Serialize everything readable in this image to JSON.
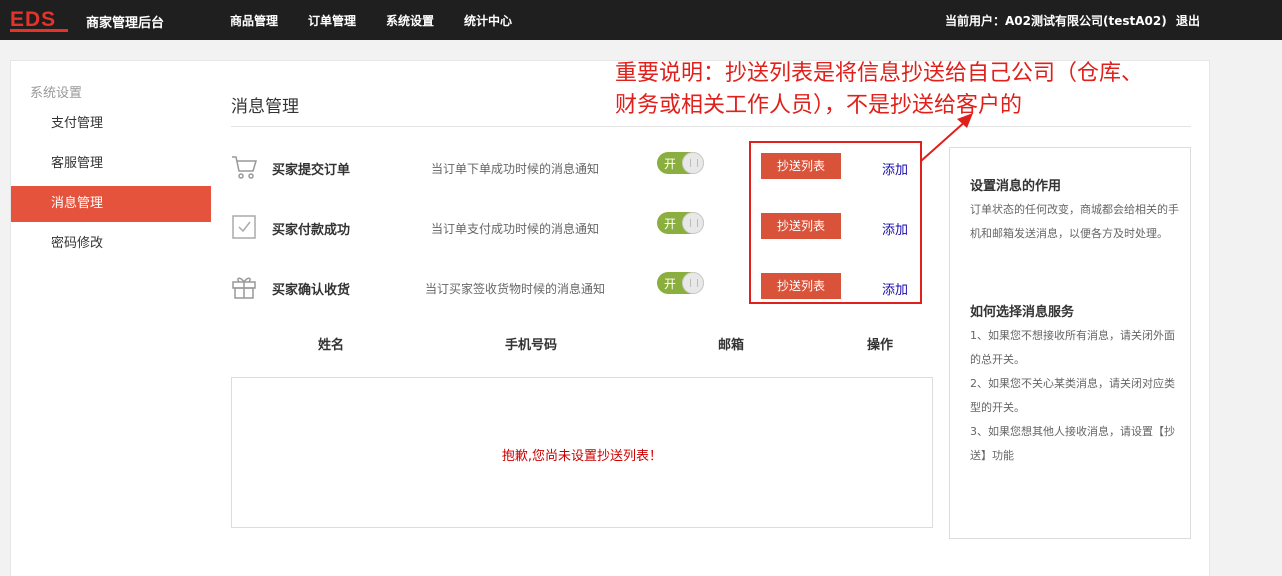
{
  "header": {
    "logo_text": "EDS",
    "brand": "商家管理后台",
    "nav": [
      "商品管理",
      "订单管理",
      "系统设置",
      "统计中心"
    ],
    "user_info": "当前用户：A02测试有限公司(testA02)",
    "logout": "退出"
  },
  "sidebar": {
    "group": "系统设置",
    "items": [
      {
        "label": "支付管理",
        "active": false
      },
      {
        "label": "客服管理",
        "active": false
      },
      {
        "label": "消息管理",
        "active": true
      },
      {
        "label": "密码修改",
        "active": false
      }
    ]
  },
  "main": {
    "title": "消息管理",
    "rows": [
      {
        "icon": "cart-icon",
        "name": "买家提交订单",
        "desc": "当订单下单成功时候的消息通知",
        "toggle": "开",
        "cc_button": "抄送列表",
        "add": "添加"
      },
      {
        "icon": "checkbox-icon",
        "name": "买家付款成功",
        "desc": "当订单支付成功时候的消息通知",
        "toggle": "开",
        "cc_button": "抄送列表",
        "add": "添加"
      },
      {
        "icon": "gift-icon",
        "name": "买家确认收货",
        "desc": "当订买家签收货物时候的消息通知",
        "toggle": "开",
        "cc_button": "抄送列表",
        "add": "添加"
      }
    ],
    "table": {
      "columns": [
        "姓名",
        "手机号码",
        "邮箱",
        "操作"
      ],
      "empty_message": "抱歉,您尚未设置抄送列表！"
    }
  },
  "help": {
    "title1": "设置消息的作用",
    "text1": "订单状态的任何改变，商城都会给相关的手机和邮箱发送消息，以便各方及时处理。",
    "title2": "如何选择消息服务",
    "items": [
      "1、如果您不想接收所有消息，请关闭外面的总开关。",
      "2、如果您不关心某类消息，请关闭对应类型的开关。",
      "3、如果您想其他人接收消息，请设置【抄送】功能"
    ]
  },
  "annotation": {
    "line1": "重要说明：抄送列表是将信息抄送给自己公司（仓库、",
    "line2": "财务或相关工作人员），不是抄送给客户的"
  },
  "colors": {
    "topbar": "#1f1f1f",
    "accent": "#e5533d",
    "button": "#d9533b",
    "toggle_on": "#8aaf3e",
    "annotation": "#e0201b",
    "link": "#1a0dab"
  }
}
